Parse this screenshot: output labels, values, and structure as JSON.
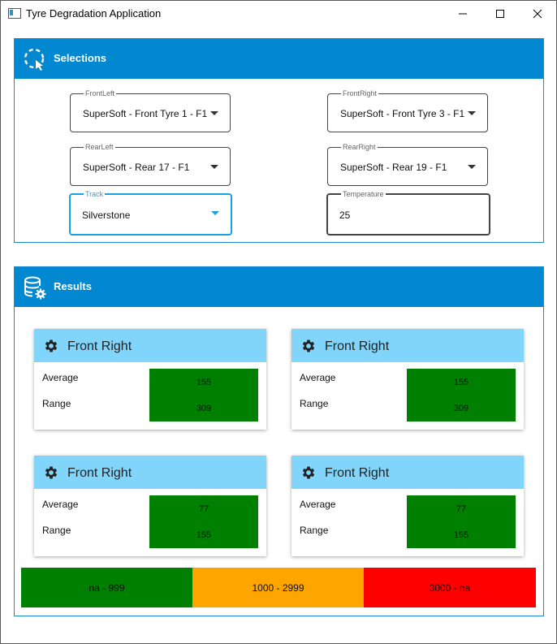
{
  "window": {
    "title": "Tyre Degradation Application"
  },
  "selections": {
    "title": "Selections",
    "front_left": {
      "label": "FrontLeft",
      "value": "SuperSoft - Front Tyre 1 - F1"
    },
    "front_right": {
      "label": "FrontRight",
      "value": "SuperSoft - Front Tyre 3 - F1"
    },
    "rear_left": {
      "label": "RearLeft",
      "value": "SuperSoft - Rear 17 - F1"
    },
    "rear_right": {
      "label": "RearRight",
      "value": "SuperSoft - Rear 19 - F1"
    },
    "track": {
      "label": "Track",
      "value": "Silverstone"
    },
    "temperature": {
      "label": "Temperature",
      "value": "25"
    }
  },
  "results": {
    "title": "Results",
    "average_label": "Average",
    "range_label": "Range",
    "cards": [
      {
        "title": "Front Right",
        "average": "155",
        "range": "309"
      },
      {
        "title": "Front Right",
        "average": "155",
        "range": "309"
      },
      {
        "title": "Front Right",
        "average": "77",
        "range": "155"
      },
      {
        "title": "Front Right",
        "average": "77",
        "range": "155"
      }
    ],
    "value_color": "#008000"
  },
  "legend": [
    {
      "label": "na - 999",
      "color": "#008000"
    },
    {
      "label": "1000 - 2999",
      "color": "#ffa500"
    },
    {
      "label": "3000 - na",
      "color": "#ff0000"
    }
  ],
  "colors": {
    "accent": "#0288d1",
    "card_header": "#81d4fa",
    "focus": "#1ba1e2"
  }
}
